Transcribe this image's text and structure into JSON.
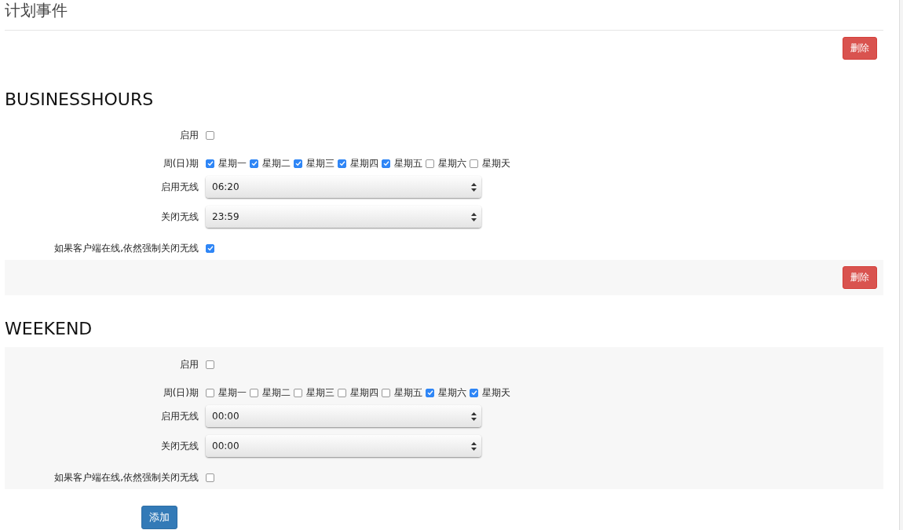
{
  "page": {
    "title": "计划事件"
  },
  "sections": [
    {
      "name": "BUSINESSHOURS",
      "color": "#ffffff",
      "delete_button": "删除",
      "fields": [
        {
          "kind": "checkbox",
          "label": "启用",
          "checked": false
        },
        {
          "kind": "weekdays",
          "label": "周(日)期",
          "days": [
            {
              "label": "星期一",
              "checked": true
            },
            {
              "label": "星期二",
              "checked": true
            },
            {
              "label": "星期三",
              "checked": true
            },
            {
              "label": "星期四",
              "checked": true
            },
            {
              "label": "星期五",
              "checked": true
            },
            {
              "label": "星期六",
              "checked": false
            },
            {
              "label": "星期天",
              "checked": false
            }
          ]
        },
        {
          "kind": "select",
          "label": "启用无线",
          "value": "06:20"
        },
        {
          "kind": "select",
          "label": "关闭无线",
          "value": "23:59"
        },
        {
          "kind": "checkbox",
          "label": "如果客户端在线,依然强制关闭无线",
          "checked": true
        }
      ]
    },
    {
      "name": "WEEKEND",
      "color": "#f7f7f7",
      "delete_button": "删除",
      "fields": [
        {
          "kind": "checkbox",
          "label": "启用",
          "checked": false
        },
        {
          "kind": "weekdays",
          "label": "周(日)期",
          "days": [
            {
              "label": "星期一",
              "checked": false
            },
            {
              "label": "星期二",
              "checked": false
            },
            {
              "label": "星期三",
              "checked": false
            },
            {
              "label": "星期四",
              "checked": false
            },
            {
              "label": "星期五",
              "checked": false
            },
            {
              "label": "星期六",
              "checked": true
            },
            {
              "label": "星期天",
              "checked": true
            }
          ]
        },
        {
          "kind": "select",
          "label": "启用无线",
          "value": "00:00"
        },
        {
          "kind": "select",
          "label": "关闭无线",
          "value": "00:00"
        },
        {
          "kind": "checkbox",
          "label": "如果客户端在线,依然强制关闭无线",
          "checked": false
        }
      ]
    }
  ],
  "add_button": "添加"
}
